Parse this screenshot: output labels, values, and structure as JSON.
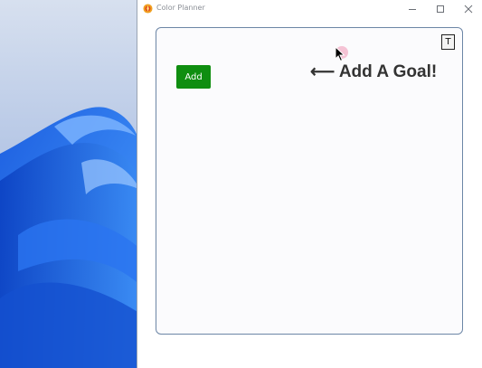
{
  "window": {
    "title": "Color Planner",
    "icon": "app-logo-icon",
    "controls": {
      "minimize": "minimize-icon",
      "maximize": "maximize-icon",
      "close": "close-icon"
    }
  },
  "panel": {
    "t_button_label": "T",
    "add_button_label": "Add",
    "hint_arrow": "⟵",
    "hint_text": "Add A Goal!"
  },
  "colors": {
    "add_button": "#0f8e10",
    "panel_border": "#6c86a6",
    "panel_bg": "#fbfbfd"
  }
}
